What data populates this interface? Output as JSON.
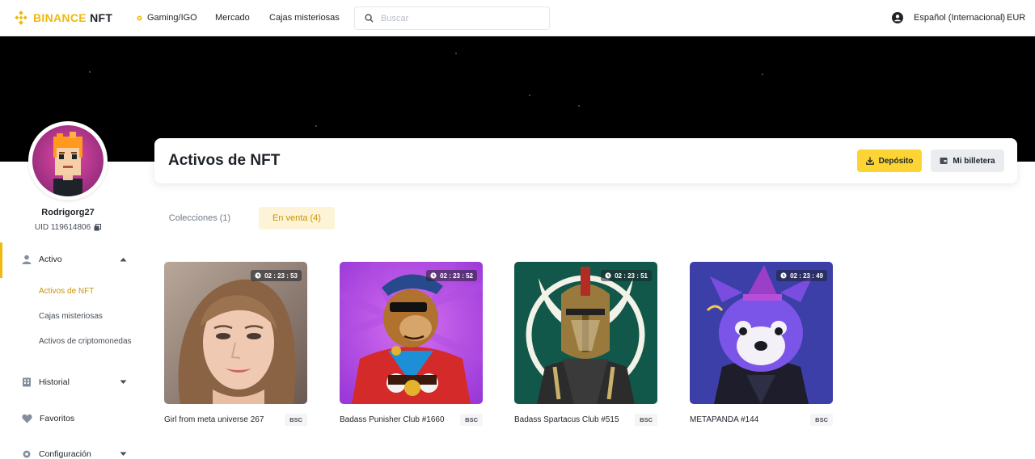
{
  "header": {
    "brand_main": "BINANCE",
    "brand_sub": "NFT",
    "nav": [
      "Gaming/IGO",
      "Mercado",
      "Cajas misteriosas"
    ],
    "search_placeholder": "Buscar",
    "language": "Español (Internacional)",
    "currency": "EUR"
  },
  "profile": {
    "username": "Rodrigorg27",
    "uid": "UID 119614806"
  },
  "sidebar": {
    "items": [
      {
        "label": "Activo",
        "icon": "user-icon",
        "expanded": true
      },
      {
        "label": "Historial",
        "icon": "grid-icon",
        "expanded": false
      },
      {
        "label": "Favoritos",
        "icon": "heart-icon"
      },
      {
        "label": "Configuración",
        "icon": "gear-icon",
        "expanded": false
      }
    ],
    "sub_items": [
      "Activos de NFT",
      "Cajas misteriosas",
      "Activos de criptomonedas"
    ],
    "active_sub": "Activos de NFT"
  },
  "main": {
    "title": "Activos de NFT",
    "deposit_label": "Depósito",
    "wallet_label": "Mi billetera",
    "tabs": [
      "Colecciones (1)",
      "En venta (4)"
    ],
    "active_tab": "En venta (4)"
  },
  "nfts": [
    {
      "name": "Girl from meta universe 267",
      "timer": "02 : 23 : 53",
      "chain": "BSC"
    },
    {
      "name": "Badass Punisher Club #1660",
      "timer": "02 : 23 : 52",
      "chain": "BSC"
    },
    {
      "name": "Badass Spartacus Club #515",
      "timer": "02 : 23 : 51",
      "chain": "BSC"
    },
    {
      "name": "METAPANDA #144",
      "timer": "02 : 23 : 49",
      "chain": "BSC"
    }
  ],
  "colors": {
    "accent": "#f0b90b",
    "button_yellow": "#fcd535",
    "active_tab_bg": "#fdf4d7",
    "text_primary": "#1e2329"
  }
}
